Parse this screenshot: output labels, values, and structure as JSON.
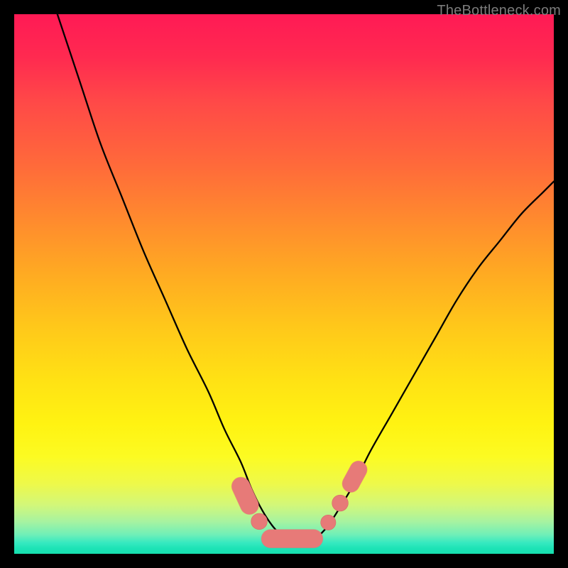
{
  "watermark": "TheBottleneck.com",
  "colors": {
    "curve_stroke": "#000000",
    "marker_fill": "#e77a78",
    "marker_stroke": "#d86866",
    "background": "#000000"
  },
  "chart_data": {
    "type": "line",
    "title": "",
    "xlabel": "",
    "ylabel": "",
    "xlim": [
      0,
      100
    ],
    "ylim": [
      0,
      100
    ],
    "grid": false,
    "legend": false,
    "note": "Axes are implicit (no tick labels shown). Values estimated from pixel positions on a 0–100 normalized plot area where y=0 is bottom (green) and y=100 is top (red).",
    "series": [
      {
        "name": "bottleneck-curve",
        "x": [
          8,
          12,
          16,
          20,
          24,
          28,
          32,
          36,
          39,
          42,
          44,
          46,
          48,
          50,
          52,
          54,
          56,
          58,
          60,
          63,
          66,
          70,
          74,
          78,
          82,
          86,
          90,
          94,
          98,
          100
        ],
        "y": [
          100,
          88,
          76,
          66,
          56,
          47,
          38,
          30,
          23,
          17,
          12,
          8,
          5,
          3,
          2,
          2,
          3,
          5,
          8,
          13,
          19,
          26,
          33,
          40,
          47,
          53,
          58,
          63,
          67,
          69
        ]
      }
    ],
    "markers": [
      {
        "name": "left-upper-capsule",
        "kind": "capsule",
        "x1": 42.0,
        "y1": 12.5,
        "x2": 43.6,
        "y2": 9.0,
        "r": 1.7
      },
      {
        "name": "left-lower-dot",
        "kind": "dot",
        "x": 45.4,
        "y": 6.0,
        "r": 1.5
      },
      {
        "name": "bottom-capsule",
        "kind": "capsule",
        "x1": 47.5,
        "y1": 2.8,
        "x2": 55.5,
        "y2": 2.8,
        "r": 1.7
      },
      {
        "name": "right-lower-dot",
        "kind": "dot",
        "x": 58.2,
        "y": 5.8,
        "r": 1.4
      },
      {
        "name": "right-upper-dot",
        "kind": "dot",
        "x": 60.4,
        "y": 9.4,
        "r": 1.5
      },
      {
        "name": "right-capsule",
        "kind": "capsule",
        "x1": 62.4,
        "y1": 13.0,
        "x2": 63.8,
        "y2": 15.6,
        "r": 1.6
      }
    ]
  }
}
